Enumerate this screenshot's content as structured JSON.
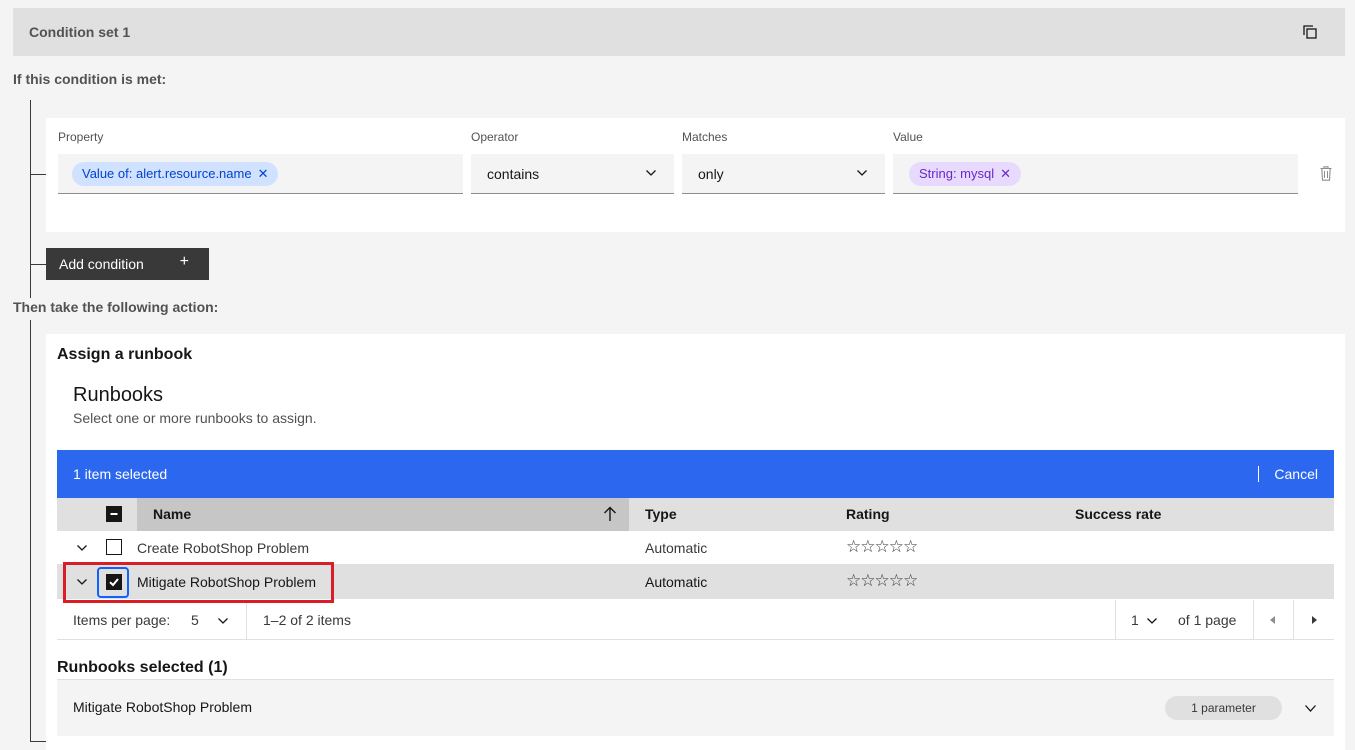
{
  "condition_set": {
    "title": "Condition set 1",
    "copy_icon": "copy-icon"
  },
  "condition_label": "If this condition is met:",
  "condition": {
    "property_label": "Property",
    "property_tag": "Value of: alert.resource.name",
    "operator_label": "Operator",
    "operator_value": "contains",
    "matches_label": "Matches",
    "matches_value": "only",
    "value_label": "Value",
    "value_tag": "String: mysql",
    "tag_remove": "✕"
  },
  "add_condition": {
    "label": "Add condition",
    "icon": "+"
  },
  "action_label": "Then take the following action:",
  "action": {
    "title": "Assign a runbook",
    "runbooks_title": "Runbooks",
    "runbooks_subtitle": "Select one or more runbooks to assign.",
    "batch": {
      "selected_text": "1 item selected",
      "cancel": "Cancel",
      "color": "#2c67f0"
    },
    "columns": [
      "Name",
      "Type",
      "Rating",
      "Success rate"
    ],
    "rows": [
      {
        "name": "Create RobotShop Problem",
        "type": "Automatic",
        "rating": "☆☆☆☆☆",
        "success_rate": "",
        "checked": false
      },
      {
        "name": "Mitigate RobotShop Problem",
        "type": "Automatic",
        "rating": "☆☆☆☆☆",
        "success_rate": "",
        "checked": true
      }
    ],
    "pagination": {
      "items_per_page_label": "Items per page:",
      "items_per_page": "5",
      "range": "1–2 of 2 items",
      "page": "1",
      "of_pages": "of 1 page"
    },
    "selected_title": "Runbooks selected (1)",
    "selected_items": [
      {
        "name": "Mitigate RobotShop Problem",
        "param": "1 parameter"
      }
    ]
  }
}
